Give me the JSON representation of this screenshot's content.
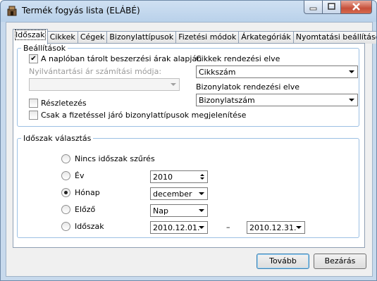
{
  "window": {
    "title": "Termék fogyás lista (ELÁBÉ)"
  },
  "tabs": [
    "Időszak",
    "Cikkek",
    "Cégek",
    "Bizonylattípusok",
    "Fizetési módok",
    "Árkategóriák",
    "Nyomtatási beállítások"
  ],
  "settings": {
    "legend": "Beállítások",
    "use_log_prices": {
      "label": "A naplóban tárolt beszerzési árak alapján",
      "checked": true
    },
    "inventory_method": {
      "label": "Nyilvántartási ár számítási módja:",
      "value": ""
    },
    "items_sort": {
      "label": "Cikkek rendezési elve",
      "value": "Cikkszám"
    },
    "docs_sort": {
      "label": "Bizonylatok rendezési elve",
      "value": "Bizonylatszám"
    },
    "details": {
      "label": "Részletezés",
      "checked": false
    },
    "paid_only": {
      "label": "Csak a fizetéssel járó bizonylattípusok megjelenítése",
      "checked": false
    }
  },
  "period": {
    "legend": "Időszak választás",
    "options": {
      "none": "Nincs időszak szűrés",
      "year": "Év",
      "month": "Hónap",
      "previous": "Előző",
      "range": "Időszak"
    },
    "selected": "month",
    "year_value": "2010",
    "month_value": "december",
    "previous_value": "Nap",
    "range_from": "2010.12.01.",
    "range_separator": "–",
    "range_to": "2010.12.31."
  },
  "buttons": {
    "next": "Tovább",
    "close": "Bezárás"
  }
}
